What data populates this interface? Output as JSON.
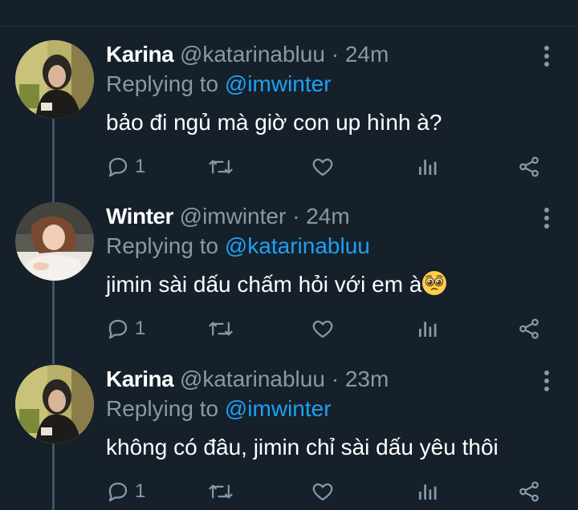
{
  "colors": {
    "background": "#15202b",
    "text_primary": "#ffffff",
    "text_secondary": "#8899a6",
    "accent": "#1da1f2",
    "thread_line": "#3d5466"
  },
  "tweets": [
    {
      "name": "Karina",
      "handle": "@katarinabluu",
      "separator": "·",
      "time": "24m",
      "replying_prefix": "Replying to",
      "replying_to": "@imwinter",
      "text": "bảo đi ngủ mà giờ con up hình à?",
      "emoji": "",
      "reply_count": "1",
      "avatar_icon": "avatar-karina",
      "icons": [
        "reply-icon",
        "retweet-icon",
        "like-icon",
        "analytics-icon",
        "share-icon",
        "more-icon"
      ]
    },
    {
      "name": "Winter",
      "handle": "@imwinter",
      "separator": "·",
      "time": "24m",
      "replying_prefix": "Replying to",
      "replying_to": "@katarinabluu",
      "text": "jimin sài dấu chấm hỏi với em à",
      "emoji": "pleading-face-emoji",
      "reply_count": "1",
      "avatar_icon": "avatar-winter",
      "icons": [
        "reply-icon",
        "retweet-icon",
        "like-icon",
        "analytics-icon",
        "share-icon",
        "more-icon"
      ]
    },
    {
      "name": "Karina",
      "handle": "@katarinabluu",
      "separator": "·",
      "time": "23m",
      "replying_prefix": "Replying to",
      "replying_to": "@imwinter",
      "text": "không có đâu, jimin chỉ sài dấu yêu thôi",
      "emoji": "",
      "reply_count": "1",
      "avatar_icon": "avatar-karina",
      "icons": [
        "reply-icon",
        "retweet-icon",
        "like-icon",
        "analytics-icon",
        "share-icon",
        "more-icon"
      ]
    }
  ]
}
